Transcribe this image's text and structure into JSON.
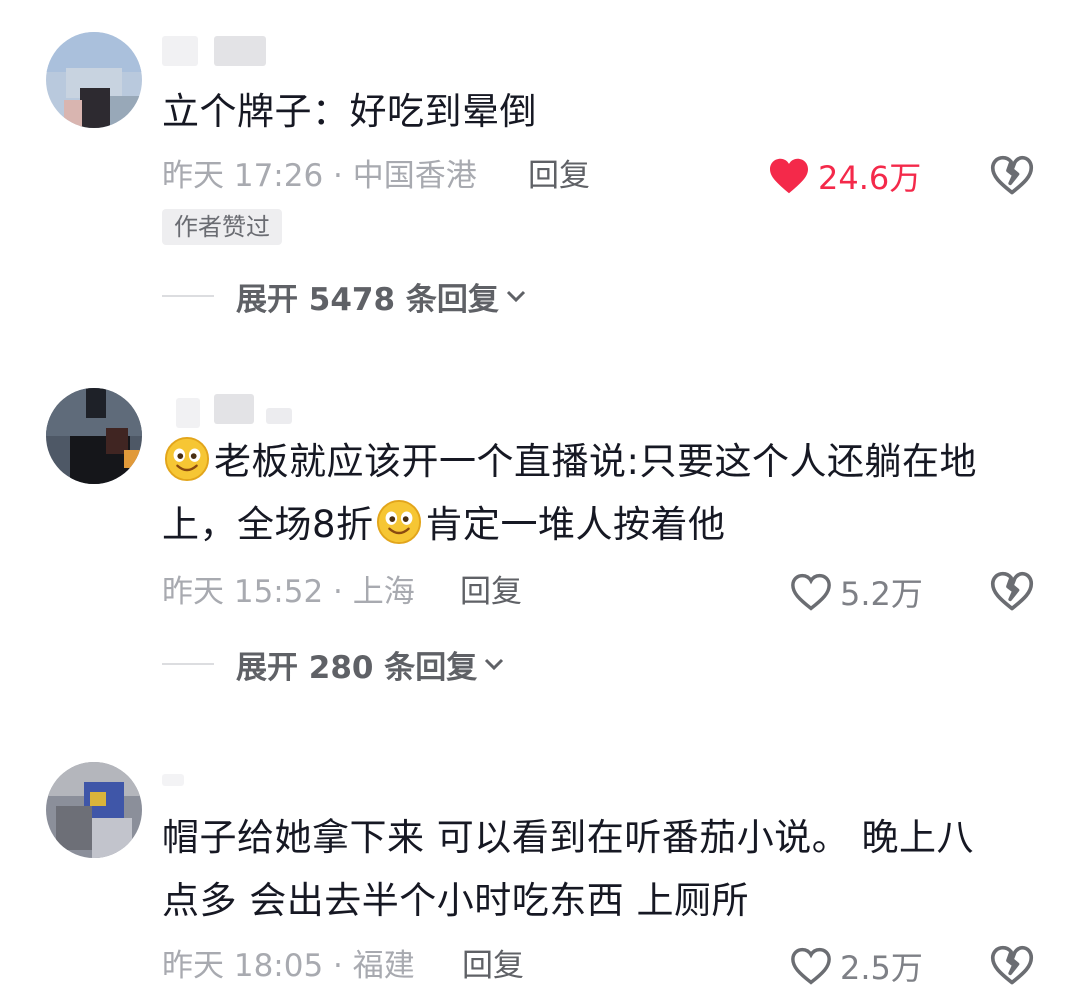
{
  "comments": [
    {
      "text_lines": [
        "立个牌子：好吃到晕倒"
      ],
      "time": "昨天 17:26 · 中国香港",
      "reply_label": "回复",
      "likes": "24.6万",
      "liked": true,
      "author_badge": "作者赞过",
      "expand": {
        "label": "展开 5478 条回复"
      }
    },
    {
      "text_line1": "老板就应该开一个直播说:只要这个人还躺在地",
      "text_line2_a": "上，全场8折",
      "text_line2_b": "肯定一堆人按着他",
      "time": "昨天 15:52 · 上海",
      "reply_label": "回复",
      "likes": "5.2万",
      "liked": false,
      "expand": {
        "label": "展开 280 条回复"
      }
    },
    {
      "text_lines": [
        "帽子给她拿下来 可以看到在听番茄小说。 晚上八",
        "点多 会出去半个小时吃东西 上厕所"
      ],
      "time": "昨天 18:05 · 福建",
      "reply_label": "回复",
      "likes": "2.5万",
      "liked": false
    }
  ],
  "icons": {
    "like": "heart-icon",
    "dislike": "broken-heart-icon",
    "expand": "chevron-down-icon",
    "emoji": "smile-emoji-icon"
  },
  "colors": {
    "liked": "#f4294a",
    "meta": "#a8aab0",
    "text": "#161823"
  }
}
